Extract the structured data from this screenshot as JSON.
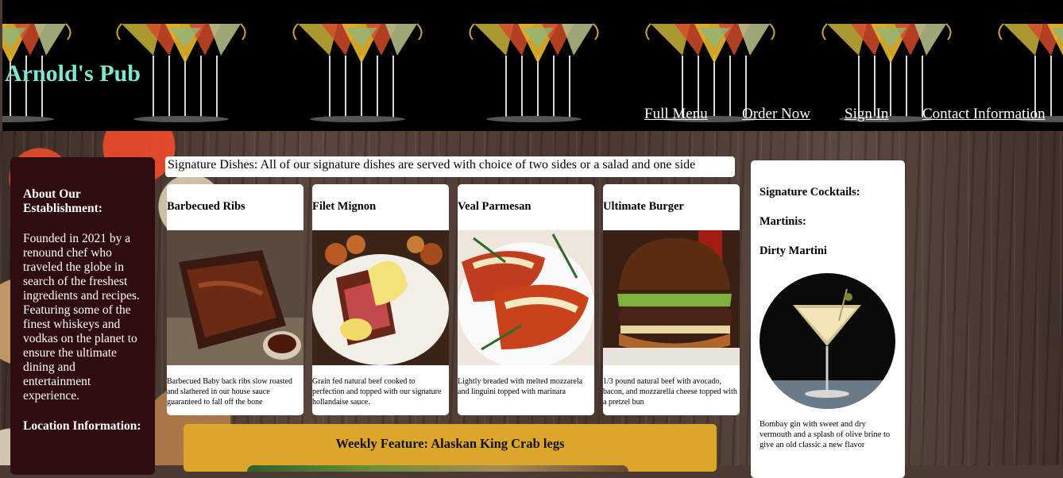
{
  "header": {
    "title": "Arnold's Pub",
    "nav": [
      "Full Menu",
      "Order Now",
      "Sign In",
      "Contact Information"
    ]
  },
  "about": {
    "heading": "About Our Establishment:",
    "body": "Founded in 2021 by a renound chef who traveled the globe in search of the freshest ingredients and recipes. Featuring some of the finest whiskeys and vodkas on the planet to ensure the ultimate dining and entertainment experience.",
    "location_heading": "Location Information:"
  },
  "signature": {
    "banner": "Signature Dishes: All of our signature dishes are served with choice of two sides or a salad and one side",
    "dishes": [
      {
        "name": "Barbecued Ribs",
        "desc": "Barbecued Baby back ribs slow roasted and slathered in our house sauce guaranteed to fall off the bone",
        "icon": "ribs-photo"
      },
      {
        "name": "Filet Mignon",
        "desc": "Grain fed natural beef cooked to perfection and topped with our signature hollandaise sauce.",
        "icon": "steak-photo"
      },
      {
        "name": "Veal Parmesan",
        "desc": "Lightly breaded with melted mozzarela and linguini topped with marinara",
        "icon": "veal-photo"
      },
      {
        "name": "Ultimate Burger",
        "desc": "1/3 pound natural beef with avocado, bacon, and mozzarella cheese topped with a pretzel bun",
        "icon": "burger-photo"
      }
    ]
  },
  "weekly": {
    "title": "Weekly Feature: Alaskan King Crab legs"
  },
  "cocktails": {
    "heading": "Signature Cocktails:",
    "category": "Martinis:",
    "drink": "Dirty Martini",
    "desc": "Bombay gin with sweet and dry vermouth and a splash of olive brine to give an old classic a new flavor"
  },
  "colors": {
    "title": "#7fe7cf",
    "about_bg": "#2e0c10",
    "weekly_bg": "#dba62a"
  }
}
